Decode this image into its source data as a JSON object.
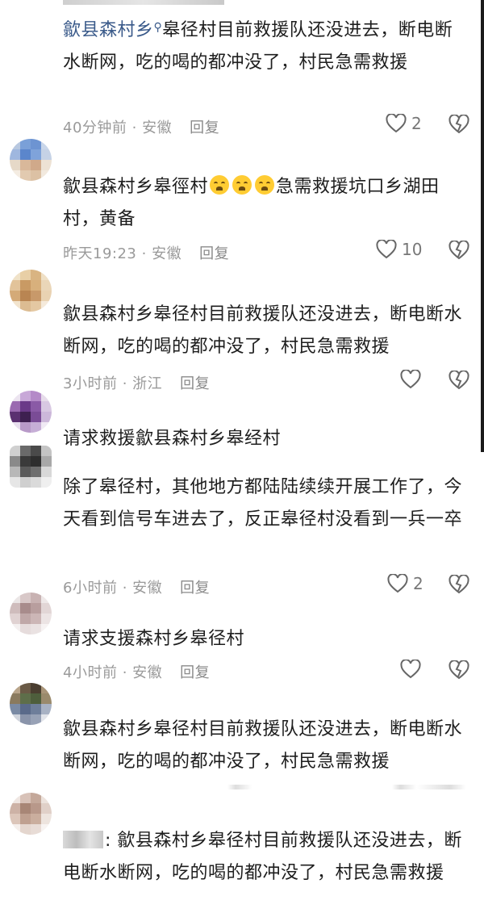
{
  "comments": [
    {
      "text_mention": "歙县森村乡",
      "text_body": "皋径村目前救援队还没进去，断电断水断网，吃的喝的都冲没了，村民急需救援",
      "time": "40分钟前",
      "location": "安徽",
      "reply": "回复",
      "likes": "2"
    },
    {
      "text_before": "歙县森村乡皋徑村",
      "text_after": "急需救援坑口乡湖田村，黄备",
      "time": "昨天19:23",
      "location": "安徽",
      "reply": "回复",
      "likes": "10"
    },
    {
      "text": "歙县森村乡皋径村目前救援队还没进去，断电断水断网，吃的喝的都冲没了，村民急需救援",
      "time": "3小时前",
      "location": "浙江",
      "reply": "回复"
    },
    {
      "text": "请求救援歙县森村乡皋经村"
    },
    {
      "text": "除了皋径村，其他地方都陆陆续续开展工作了，今天看到信号车进去了，反正皋径村没看到一兵一卒",
      "time": "6小时前",
      "location": "安徽",
      "reply": "回复",
      "likes": "2"
    },
    {
      "text": "请求支援森村乡皋径村",
      "time": "4小时前",
      "location": "安徽",
      "reply": "回复"
    },
    {
      "text": "歙县森村乡皋径村目前救援队还没进去，断电断水断网，吃的喝的都冲没了，村民急需救援"
    },
    {
      "text": ": 歙县森村乡皋径村目前救援队还没进去，断电断水断网，吃的喝的都冲没了，村民急需救援"
    }
  ],
  "meta_separator": "·",
  "icons": {
    "like": "heart-outline-icon",
    "dislike": "broken-heart-outline-icon",
    "emoji": "crying-face-emoji"
  },
  "colors": {
    "mention": "#3a5a8a",
    "meta": "#9a9a9a"
  }
}
